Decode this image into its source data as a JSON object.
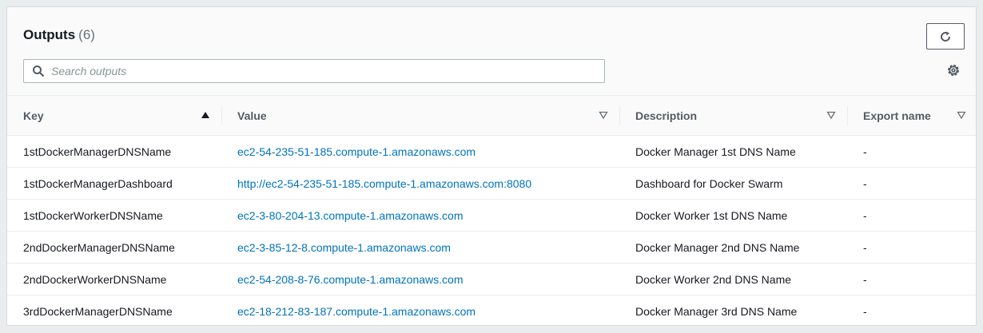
{
  "header": {
    "title": "Outputs",
    "count": "(6)"
  },
  "search": {
    "placeholder": "Search outputs"
  },
  "icons": {
    "refresh": "refresh-icon",
    "search": "search-icon",
    "settings": "gear-icon",
    "sort_asc": "caret-up-icon",
    "sort_none": "caret-down-outline-icon"
  },
  "colors": {
    "link": "#0073bb",
    "border": "#eaeded",
    "header_bg": "#fafafa"
  },
  "table": {
    "columns": [
      "Key",
      "Value",
      "Description",
      "Export name"
    ],
    "rows": [
      [
        "1stDockerManagerDNSName",
        "ec2-54-235-51-185.compute-1.amazonaws.com",
        "Docker Manager 1st DNS Name",
        "-"
      ],
      [
        "1stDockerManagerDashboard",
        "http://ec2-54-235-51-185.compute-1.amazonaws.com:8080",
        "Dashboard for Docker Swarm",
        "-"
      ],
      [
        "1stDockerWorkerDNSName",
        "ec2-3-80-204-13.compute-1.amazonaws.com",
        "Docker Worker 1st DNS Name",
        "-"
      ],
      [
        "2ndDockerManagerDNSName",
        "ec2-3-85-12-8.compute-1.amazonaws.com",
        "Docker Manager 2nd DNS Name",
        "-"
      ],
      [
        "2ndDockerWorkerDNSName",
        "ec2-54-208-8-76.compute-1.amazonaws.com",
        "Docker Worker 2nd DNS Name",
        "-"
      ],
      [
        "3rdDockerManagerDNSName",
        "ec2-18-212-83-187.compute-1.amazonaws.com",
        "Docker Manager 3rd DNS Name",
        "-"
      ]
    ]
  }
}
